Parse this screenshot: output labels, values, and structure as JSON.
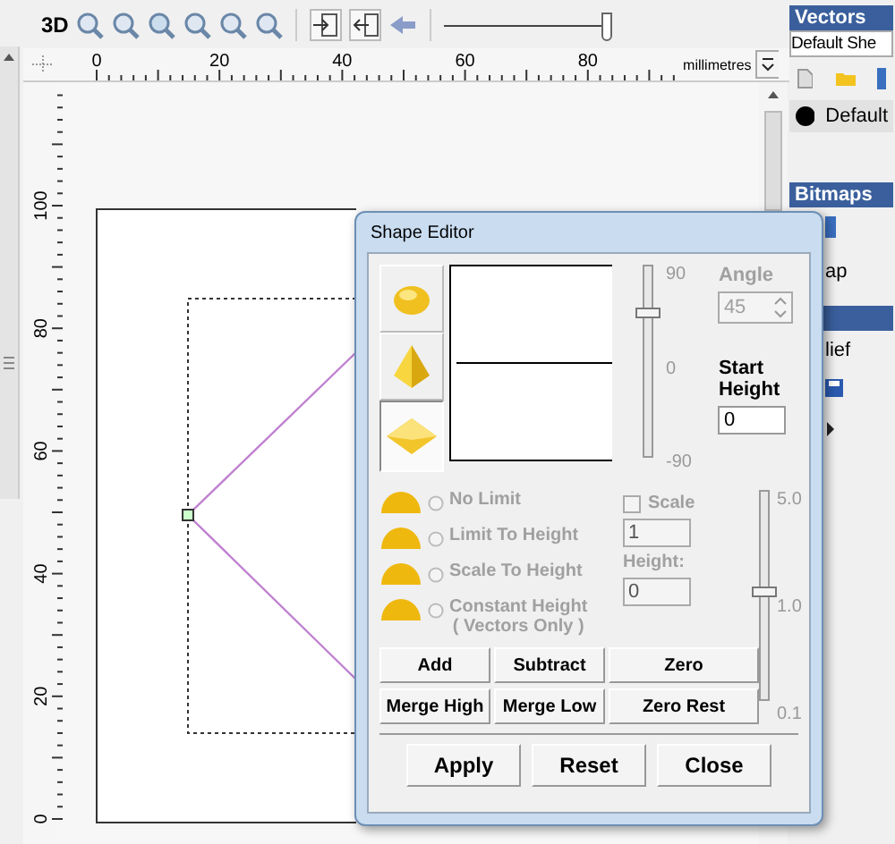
{
  "toolbar": {
    "mode_label": "3D",
    "zoom_slider": {
      "level": 1
    }
  },
  "rulers": {
    "unit": "millimetres",
    "x_labels": [
      "0",
      "20",
      "40",
      "60",
      "80"
    ],
    "y_labels": [
      "100",
      "80",
      "60",
      "40",
      "20",
      "0"
    ]
  },
  "right_panel": {
    "vectors": {
      "title": "Vectors",
      "sheet": "Default She",
      "layer": "Default"
    },
    "bitmaps": {
      "title": "Bitmaps",
      "item": "ap"
    },
    "reliefs": {
      "item": "lief"
    }
  },
  "dialog": {
    "title": "Shape Editor",
    "shapes": [
      {
        "kind": "dome",
        "selected": false
      },
      {
        "kind": "pyramid",
        "selected": false
      },
      {
        "kind": "plane",
        "selected": true
      }
    ],
    "angle_slider": {
      "ticks": [
        "90",
        "0",
        "-90"
      ],
      "level": 0.75
    },
    "angle": {
      "label": "Angle",
      "value": "45",
      "disabled": true
    },
    "start_height": {
      "label": "Start Height",
      "value": "0"
    },
    "limits": [
      {
        "label": "No Limit",
        "selected": false,
        "disabled": true
      },
      {
        "label": "Limit To Height",
        "selected": false,
        "disabled": true
      },
      {
        "label": "Scale To Height",
        "selected": false,
        "disabled": true
      },
      {
        "label": "Constant Height",
        "note": "( Vectors Only )",
        "selected": false,
        "disabled": true
      }
    ],
    "scale": {
      "label": "Scale",
      "checked": false,
      "disabled": true,
      "value": "1"
    },
    "height": {
      "label": "Height:",
      "value": "0",
      "disabled": true
    },
    "scale_slider": {
      "ticks": [
        "5.0",
        "1.0",
        "0.1"
      ],
      "level": 0.52
    },
    "ops": [
      "Add",
      "Subtract",
      "Zero",
      "Merge High",
      "Merge Low",
      "Zero Rest"
    ],
    "buttons": [
      "Apply",
      "Reset",
      "Close"
    ]
  }
}
